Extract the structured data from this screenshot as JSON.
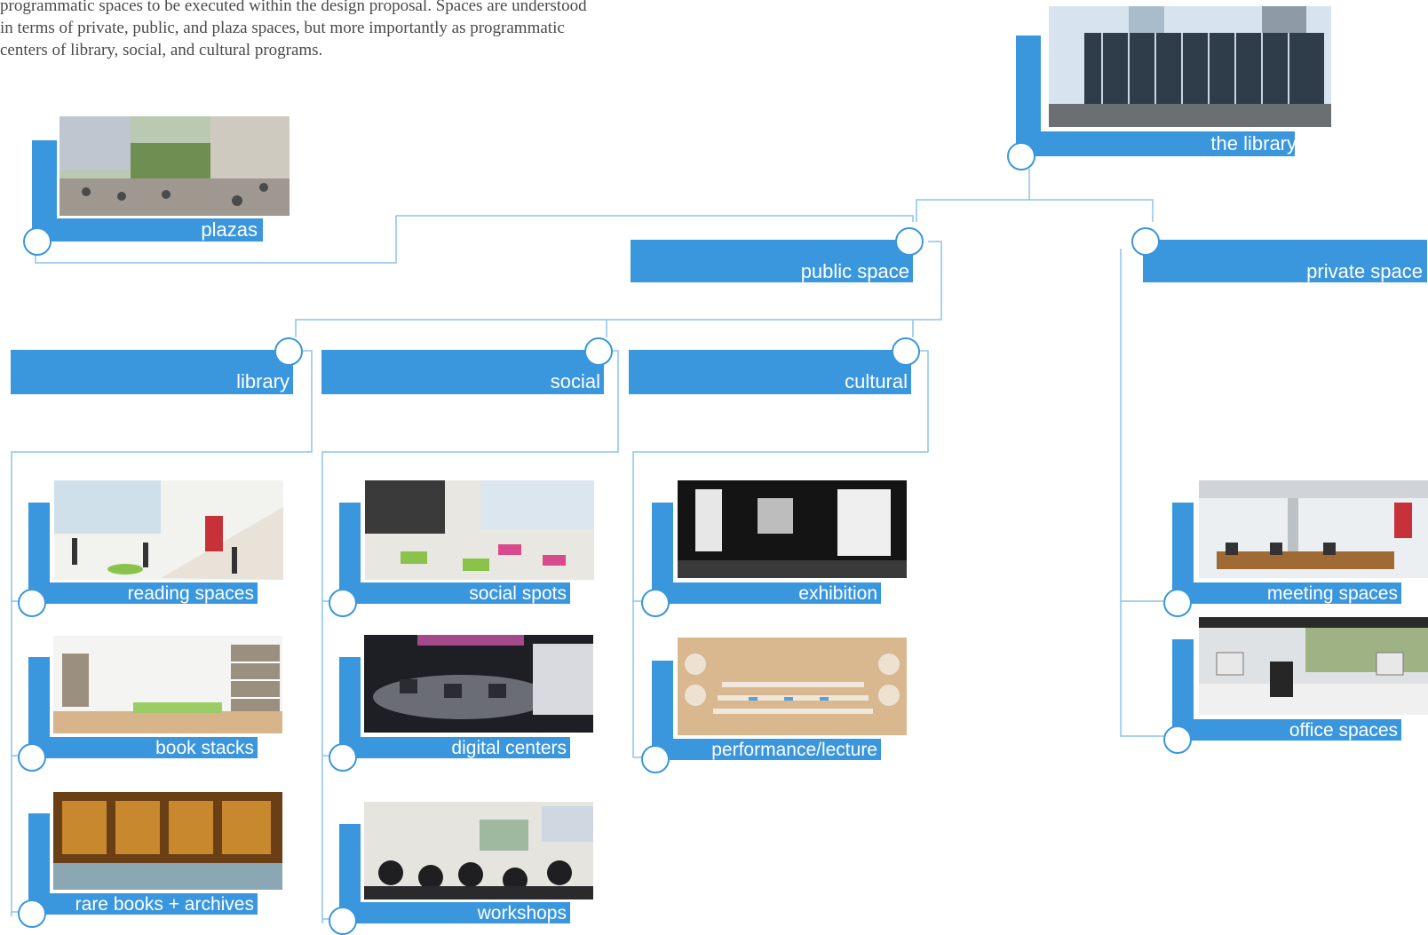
{
  "intro": {
    "line1": "programmatic spaces to be executed within the design proposal. Spaces are understood",
    "line2": "in terms of private, public, and plaza spaces, but more importantly as programmatic",
    "line3": "centers of library, social, and cultural programs."
  },
  "nodes": {
    "the_library": "the library",
    "plazas": "plazas",
    "public_space": "public space",
    "private_space": "private space",
    "library": "library",
    "social": "social",
    "cultural": "cultural",
    "reading_spaces": "reading spaces",
    "book_stacks": "book stacks",
    "rare_books": "rare books + archives",
    "social_spots": "social spots",
    "digital_centers": "digital centers",
    "workshops": "workshops",
    "exhibition": "exhibition",
    "performance": "performance/lecture",
    "meeting_spaces": "meeting spaces",
    "office_spaces": "office spaces"
  },
  "colors": {
    "accent": "#3a96dd",
    "connector": "#8cc3ec",
    "intro_text": "#4a4a4a"
  }
}
